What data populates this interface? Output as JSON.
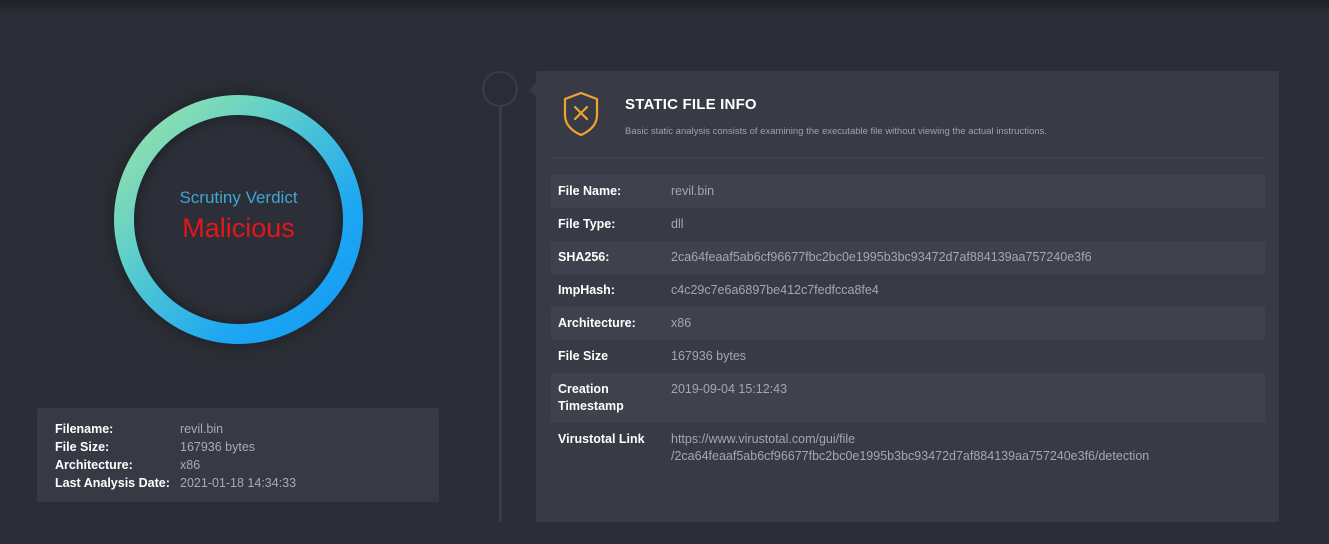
{
  "verdict": {
    "label": "Scrutiny Verdict",
    "value": "Malicious"
  },
  "summary": {
    "rows": [
      {
        "key": "Filename:",
        "value": "revil.bin"
      },
      {
        "key": "File Size:",
        "value": "167936 bytes"
      },
      {
        "key": "Architecture:",
        "value": "x86"
      },
      {
        "key": "Last Analysis Date:",
        "value": "2021-01-18 14:34:33"
      }
    ]
  },
  "static_info": {
    "icon": "shield-x-icon",
    "title": "STATIC FILE INFO",
    "subtitle": "Basic static analysis consists of examining the executable file without viewing the actual instructions.",
    "rows": [
      {
        "key": "File Name:",
        "value": "revil.bin"
      },
      {
        "key": "File Type:",
        "value": "dll"
      },
      {
        "key": "SHA256:",
        "value": "2ca64feaaf5ab6cf96677fbc2bc0e1995b3bc93472d7af884139aa757240e3f6"
      },
      {
        "key": "ImpHash:",
        "value": "c4c29c7e6a6897be412c7fedfcca8fe4"
      },
      {
        "key": "Architecture:",
        "value": "x86"
      },
      {
        "key": "File Size",
        "value": "167936 bytes"
      },
      {
        "key": "Creation\nTimestamp",
        "value": "2019-09-04 15:12:43"
      },
      {
        "key": "Virustotal Link",
        "value": "https://www.virustotal.com/gui/file\n/2ca64feaaf5ab6cf96677fbc2bc0e1995b3bc93472d7af884139aa757240e3f6/detection"
      }
    ]
  },
  "colors": {
    "background": "#2b2e36",
    "card": "#383b45",
    "verdict_label": "#3ea6d8",
    "verdict_value": "#e3161b",
    "accent_icon": "#f0a430"
  }
}
